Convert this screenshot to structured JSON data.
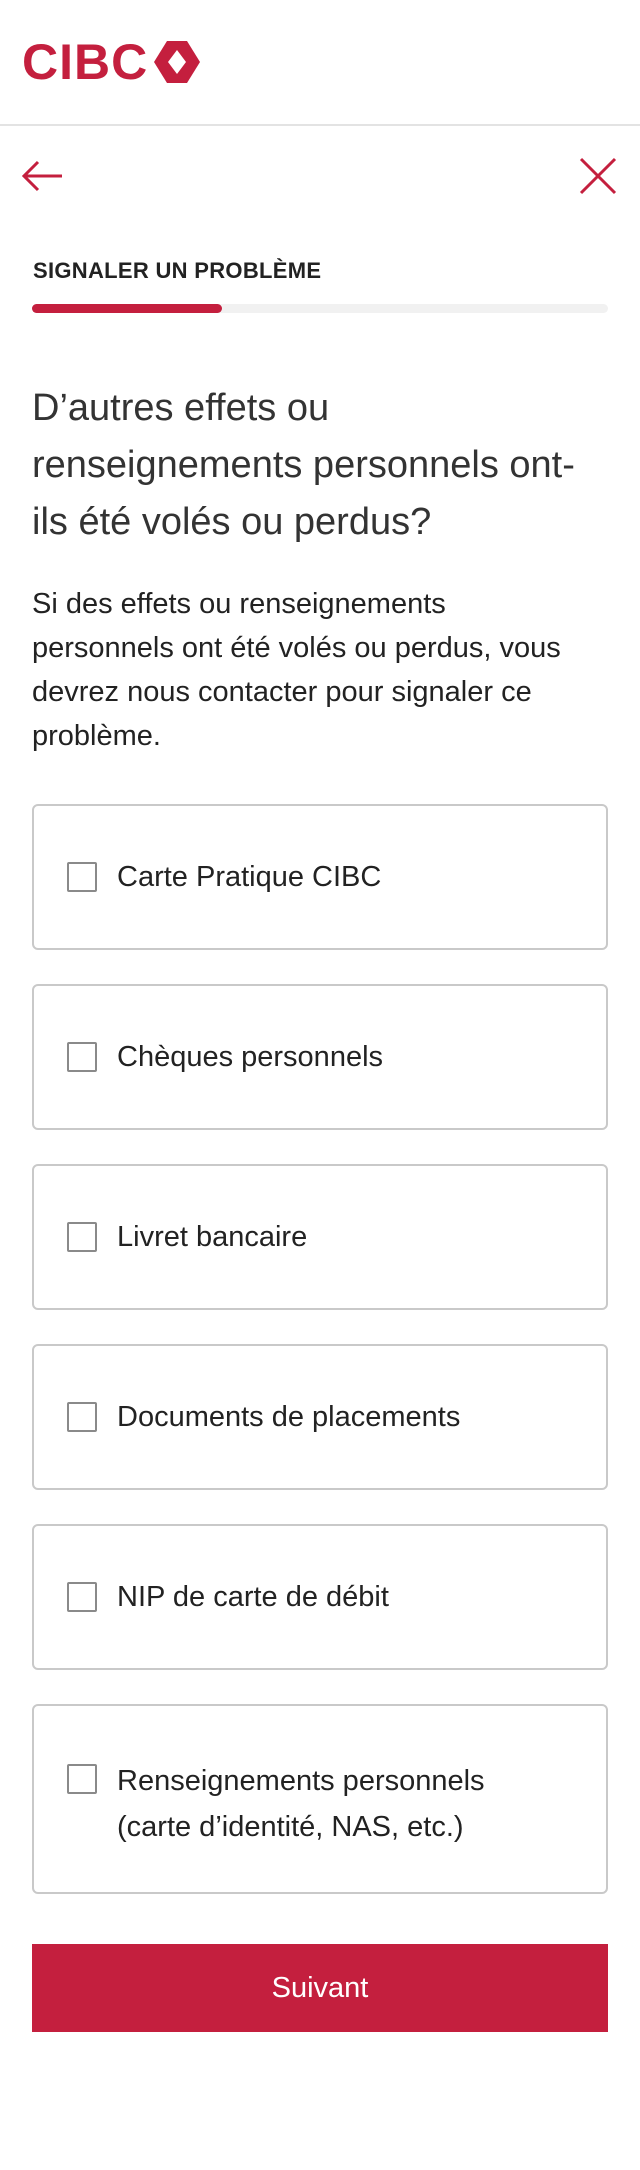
{
  "brand": {
    "logo_text": "CIBC",
    "logo_icon": "cibc-diamond-logo",
    "color": "#c41f3e"
  },
  "nav": {
    "back_icon": "arrow-left-icon",
    "close_icon": "close-icon"
  },
  "step": {
    "label": "SIGNALER UN PROBLÈME",
    "progress": 0.33
  },
  "question": "D’autres effets ou renseignements personnels ont-ils été volés ou perdus?",
  "description": "Si des effets ou renseignements personnels ont été volés ou perdus, vous devrez nous contacter pour signaler ce problème.",
  "options": [
    {
      "label": "Carte Pratique CIBC",
      "checked": false
    },
    {
      "label": "Chèques personnels",
      "checked": false
    },
    {
      "label": "Livret bancaire",
      "checked": false
    },
    {
      "label": "Documents de placements",
      "checked": false
    },
    {
      "label": "NIP de carte de débit",
      "checked": false
    },
    {
      "label": "Renseignements personnels (carte d’identité, NAS, etc.)",
      "checked": false
    }
  ],
  "next_button": "Suivant"
}
